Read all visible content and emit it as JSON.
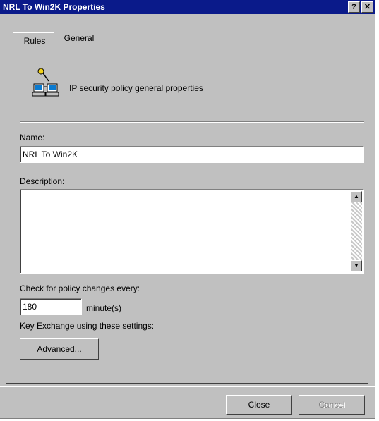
{
  "window": {
    "title": "NRL To Win2K Properties",
    "help_label": "?",
    "close_label": "✕"
  },
  "tabs": [
    {
      "label": "Rules"
    },
    {
      "label": "General"
    }
  ],
  "general": {
    "heading": "IP security policy general properties",
    "name_label": "Name:",
    "name_value": "NRL To Win2K",
    "description_label": "Description:",
    "description_value": "",
    "check_label": "Check for policy changes every:",
    "check_value": "180",
    "check_unit": "minute(s)",
    "key_exchange_label": "Key Exchange using these settings:",
    "advanced_label": "Advanced..."
  },
  "footer": {
    "close_label": "Close",
    "cancel_label": "Cancel"
  },
  "icons": {
    "policy_icon": "network-computers-key-icon",
    "scroll_up": "up-arrow-icon",
    "scroll_down": "down-arrow-icon"
  }
}
